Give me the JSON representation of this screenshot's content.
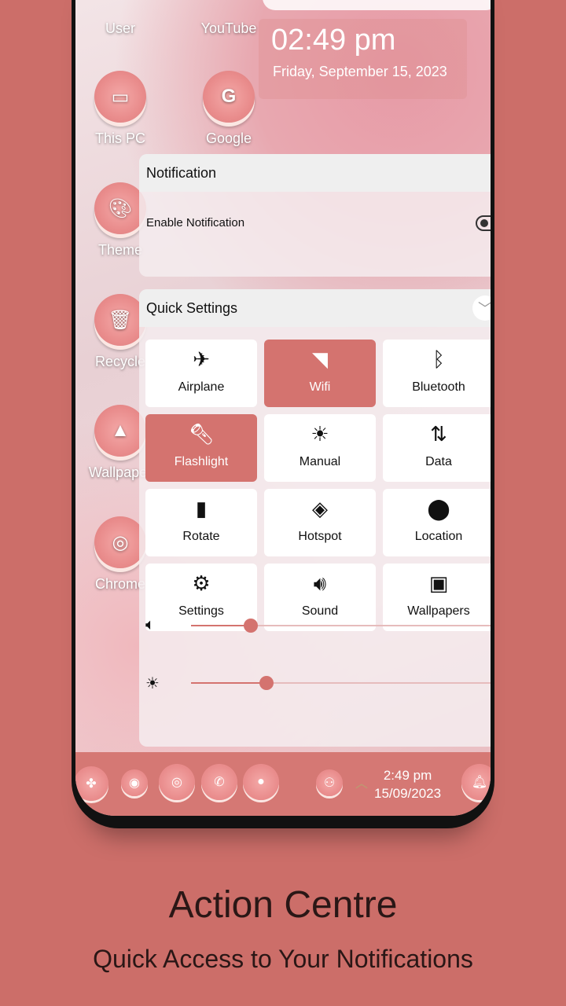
{
  "home": {
    "apps": [
      {
        "label": "User"
      },
      {
        "label": "YouTube"
      },
      {
        "label": "This PC"
      },
      {
        "label": "Google"
      },
      {
        "label": "Theme"
      },
      {
        "label": "Recycle"
      },
      {
        "label": "Wallpaper"
      },
      {
        "label": "Chrome"
      }
    ]
  },
  "clock": {
    "time": "02:49 pm",
    "date": "Friday, September 15, 2023"
  },
  "notification": {
    "title": "Notification",
    "enable_label": "Enable Notification",
    "enabled": false
  },
  "quick_settings": {
    "title": "Quick Settings",
    "tiles": [
      {
        "label": "Airplane",
        "icon": "airplane-icon",
        "active": false
      },
      {
        "label": "Wifi",
        "icon": "wifi-icon",
        "active": true
      },
      {
        "label": "Bluetooth",
        "icon": "bluetooth-icon",
        "active": false
      },
      {
        "label": "Flashlight",
        "icon": "flashlight-icon",
        "active": true
      },
      {
        "label": "Manual",
        "icon": "brightness-icon",
        "active": false
      },
      {
        "label": "Data",
        "icon": "data-icon",
        "active": false
      },
      {
        "label": "Rotate",
        "icon": "rotate-lock-icon",
        "active": false
      },
      {
        "label": "Hotspot",
        "icon": "hotspot-icon",
        "active": false
      },
      {
        "label": "Location",
        "icon": "location-icon",
        "active": false
      },
      {
        "label": "Settings",
        "icon": "gear-icon",
        "active": false
      },
      {
        "label": "Sound",
        "icon": "volume-icon",
        "active": false
      },
      {
        "label": "Wallpapers",
        "icon": "image-icon",
        "active": false
      }
    ],
    "volume_percent": 20,
    "brightness_percent": 25
  },
  "taskbar": {
    "time": "2:49 pm",
    "date": "15/09/2023"
  },
  "promo": {
    "title": "Action Centre",
    "subtitle": "Quick Access to Your Notifications"
  },
  "colors": {
    "background": "#cc6e69",
    "accent": "#d4736f"
  }
}
